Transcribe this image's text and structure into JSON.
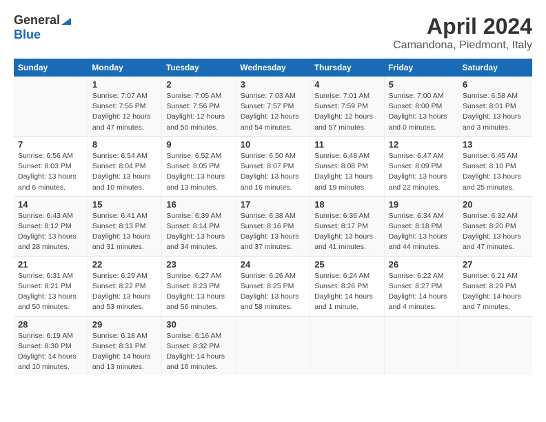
{
  "header": {
    "logo_general": "General",
    "logo_blue": "Blue",
    "title": "April 2024",
    "subtitle": "Camandona, Piedmont, Italy"
  },
  "days_of_week": [
    "Sunday",
    "Monday",
    "Tuesday",
    "Wednesday",
    "Thursday",
    "Friday",
    "Saturday"
  ],
  "weeks": [
    [
      {
        "day": "",
        "info": ""
      },
      {
        "day": "1",
        "info": "Sunrise: 7:07 AM\nSunset: 7:55 PM\nDaylight: 12 hours\nand 47 minutes."
      },
      {
        "day": "2",
        "info": "Sunrise: 7:05 AM\nSunset: 7:56 PM\nDaylight: 12 hours\nand 50 minutes."
      },
      {
        "day": "3",
        "info": "Sunrise: 7:03 AM\nSunset: 7:57 PM\nDaylight: 12 hours\nand 54 minutes."
      },
      {
        "day": "4",
        "info": "Sunrise: 7:01 AM\nSunset: 7:59 PM\nDaylight: 12 hours\nand 57 minutes."
      },
      {
        "day": "5",
        "info": "Sunrise: 7:00 AM\nSunset: 8:00 PM\nDaylight: 13 hours\nand 0 minutes."
      },
      {
        "day": "6",
        "info": "Sunrise: 6:58 AM\nSunset: 8:01 PM\nDaylight: 13 hours\nand 3 minutes."
      }
    ],
    [
      {
        "day": "7",
        "info": "Sunrise: 6:56 AM\nSunset: 8:03 PM\nDaylight: 13 hours\nand 6 minutes."
      },
      {
        "day": "8",
        "info": "Sunrise: 6:54 AM\nSunset: 8:04 PM\nDaylight: 13 hours\nand 10 minutes."
      },
      {
        "day": "9",
        "info": "Sunrise: 6:52 AM\nSunset: 8:05 PM\nDaylight: 13 hours\nand 13 minutes."
      },
      {
        "day": "10",
        "info": "Sunrise: 6:50 AM\nSunset: 8:07 PM\nDaylight: 13 hours\nand 16 minutes."
      },
      {
        "day": "11",
        "info": "Sunrise: 6:48 AM\nSunset: 8:08 PM\nDaylight: 13 hours\nand 19 minutes."
      },
      {
        "day": "12",
        "info": "Sunrise: 6:47 AM\nSunset: 8:09 PM\nDaylight: 13 hours\nand 22 minutes."
      },
      {
        "day": "13",
        "info": "Sunrise: 6:45 AM\nSunset: 8:10 PM\nDaylight: 13 hours\nand 25 minutes."
      }
    ],
    [
      {
        "day": "14",
        "info": "Sunrise: 6:43 AM\nSunset: 8:12 PM\nDaylight: 13 hours\nand 28 minutes."
      },
      {
        "day": "15",
        "info": "Sunrise: 6:41 AM\nSunset: 8:13 PM\nDaylight: 13 hours\nand 31 minutes."
      },
      {
        "day": "16",
        "info": "Sunrise: 6:39 AM\nSunset: 8:14 PM\nDaylight: 13 hours\nand 34 minutes."
      },
      {
        "day": "17",
        "info": "Sunrise: 6:38 AM\nSunset: 8:16 PM\nDaylight: 13 hours\nand 37 minutes."
      },
      {
        "day": "18",
        "info": "Sunrise: 6:36 AM\nSunset: 8:17 PM\nDaylight: 13 hours\nand 41 minutes."
      },
      {
        "day": "19",
        "info": "Sunrise: 6:34 AM\nSunset: 8:18 PM\nDaylight: 13 hours\nand 44 minutes."
      },
      {
        "day": "20",
        "info": "Sunrise: 6:32 AM\nSunset: 8:20 PM\nDaylight: 13 hours\nand 47 minutes."
      }
    ],
    [
      {
        "day": "21",
        "info": "Sunrise: 6:31 AM\nSunset: 8:21 PM\nDaylight: 13 hours\nand 50 minutes."
      },
      {
        "day": "22",
        "info": "Sunrise: 6:29 AM\nSunset: 8:22 PM\nDaylight: 13 hours\nand 53 minutes."
      },
      {
        "day": "23",
        "info": "Sunrise: 6:27 AM\nSunset: 8:23 PM\nDaylight: 13 hours\nand 56 minutes."
      },
      {
        "day": "24",
        "info": "Sunrise: 6:26 AM\nSunset: 8:25 PM\nDaylight: 13 hours\nand 58 minutes."
      },
      {
        "day": "25",
        "info": "Sunrise: 6:24 AM\nSunset: 8:26 PM\nDaylight: 14 hours\nand 1 minute."
      },
      {
        "day": "26",
        "info": "Sunrise: 6:22 AM\nSunset: 8:27 PM\nDaylight: 14 hours\nand 4 minutes."
      },
      {
        "day": "27",
        "info": "Sunrise: 6:21 AM\nSunset: 8:29 PM\nDaylight: 14 hours\nand 7 minutes."
      }
    ],
    [
      {
        "day": "28",
        "info": "Sunrise: 6:19 AM\nSunset: 8:30 PM\nDaylight: 14 hours\nand 10 minutes."
      },
      {
        "day": "29",
        "info": "Sunrise: 6:18 AM\nSunset: 8:31 PM\nDaylight: 14 hours\nand 13 minutes."
      },
      {
        "day": "30",
        "info": "Sunrise: 6:16 AM\nSunset: 8:32 PM\nDaylight: 14 hours\nand 16 minutes."
      },
      {
        "day": "",
        "info": ""
      },
      {
        "day": "",
        "info": ""
      },
      {
        "day": "",
        "info": ""
      },
      {
        "day": "",
        "info": ""
      }
    ]
  ]
}
